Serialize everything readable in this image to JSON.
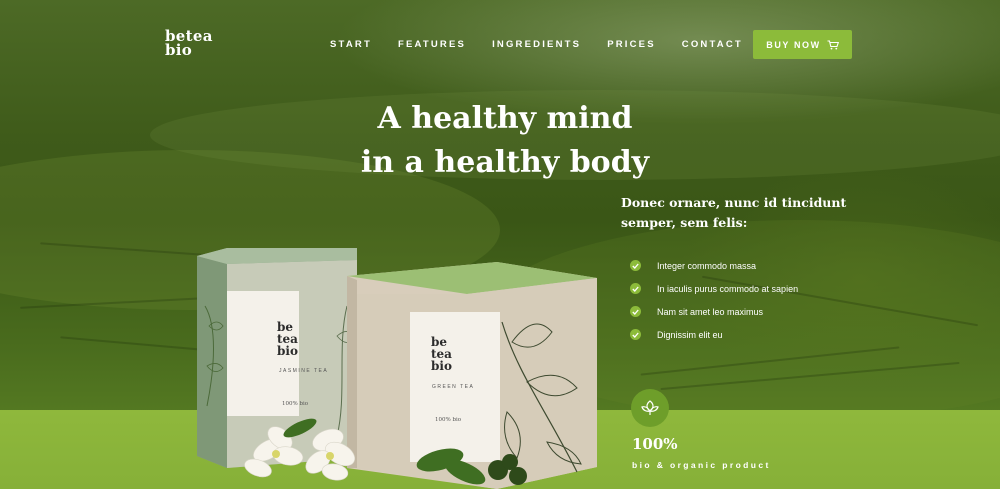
{
  "brand": {
    "logo_line1": "betea",
    "logo_line2": "bio"
  },
  "nav": {
    "items": [
      {
        "label": "START"
      },
      {
        "label": "FEATURES"
      },
      {
        "label": "INGREDIENTS"
      },
      {
        "label": "PRICES"
      },
      {
        "label": "CONTACT"
      }
    ],
    "buy_label": "BUY NOW"
  },
  "hero": {
    "headline_line1": "A healthy mind",
    "headline_line2": "in a healthy body",
    "subhead_line1": "Donec ornare, nunc id tincidunt",
    "subhead_line2": "semper, sem felis:",
    "features": [
      "Integer commodo massa",
      "In iaculis purus commodo at sapien",
      "Nam sit amet leo maximus",
      "Dignissim elit eu"
    ]
  },
  "products": [
    {
      "logo_line1": "be",
      "logo_line2": "tea",
      "logo_line3": "bio",
      "kind": "JASMINE TEA",
      "bio": "100% bio"
    },
    {
      "logo_line1": "be",
      "logo_line2": "tea",
      "logo_line3": "bio",
      "kind": "GREEN TEA",
      "bio": "100% bio"
    }
  ],
  "organic": {
    "percent": "100%",
    "label": "bio & organic product"
  },
  "colors": {
    "accent": "#8cbb3a",
    "hero_dark": "#3a5616",
    "ground": "#8fb83c"
  },
  "icons": {
    "cart": "cart-icon",
    "check": "check-icon",
    "leaf": "leaf-icon"
  }
}
